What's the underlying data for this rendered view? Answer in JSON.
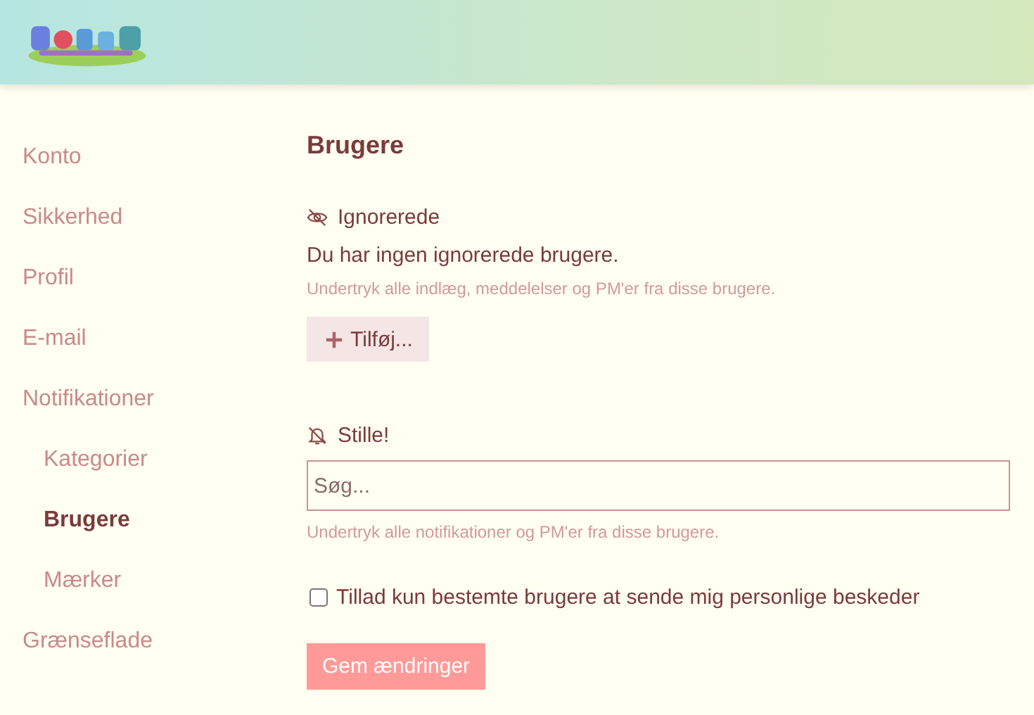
{
  "sidebar": {
    "items": [
      {
        "label": "Konto",
        "selected": false
      },
      {
        "label": "Sikkerhed",
        "selected": false
      },
      {
        "label": "Profil",
        "selected": false
      },
      {
        "label": "E-mail",
        "selected": false
      },
      {
        "label": "Notifikationer",
        "selected": false,
        "children": [
          {
            "label": "Kategorier",
            "selected": false
          },
          {
            "label": "Brugere",
            "selected": true
          },
          {
            "label": "Mærker",
            "selected": false
          }
        ]
      },
      {
        "label": "Grænseflade",
        "selected": false
      }
    ]
  },
  "page": {
    "title": "Brugere",
    "ignored": {
      "heading": "Ignorerede",
      "empty_text": "Du har ingen ignorerede brugere.",
      "hint": "Undertryk alle indlæg, meddelelser og PM'er fra disse brugere.",
      "add_button": "Tilføj..."
    },
    "muted": {
      "heading": "Stille!",
      "placeholder": "Søg...",
      "hint": "Undertryk alle notifikationer og PM'er fra disse brugere."
    },
    "restrict": {
      "label": "Tillad kun bestemte brugere at sende mig personlige beskeder",
      "checked": false
    },
    "save": {
      "label": "Gem ændringer",
      "disabled": true
    }
  }
}
